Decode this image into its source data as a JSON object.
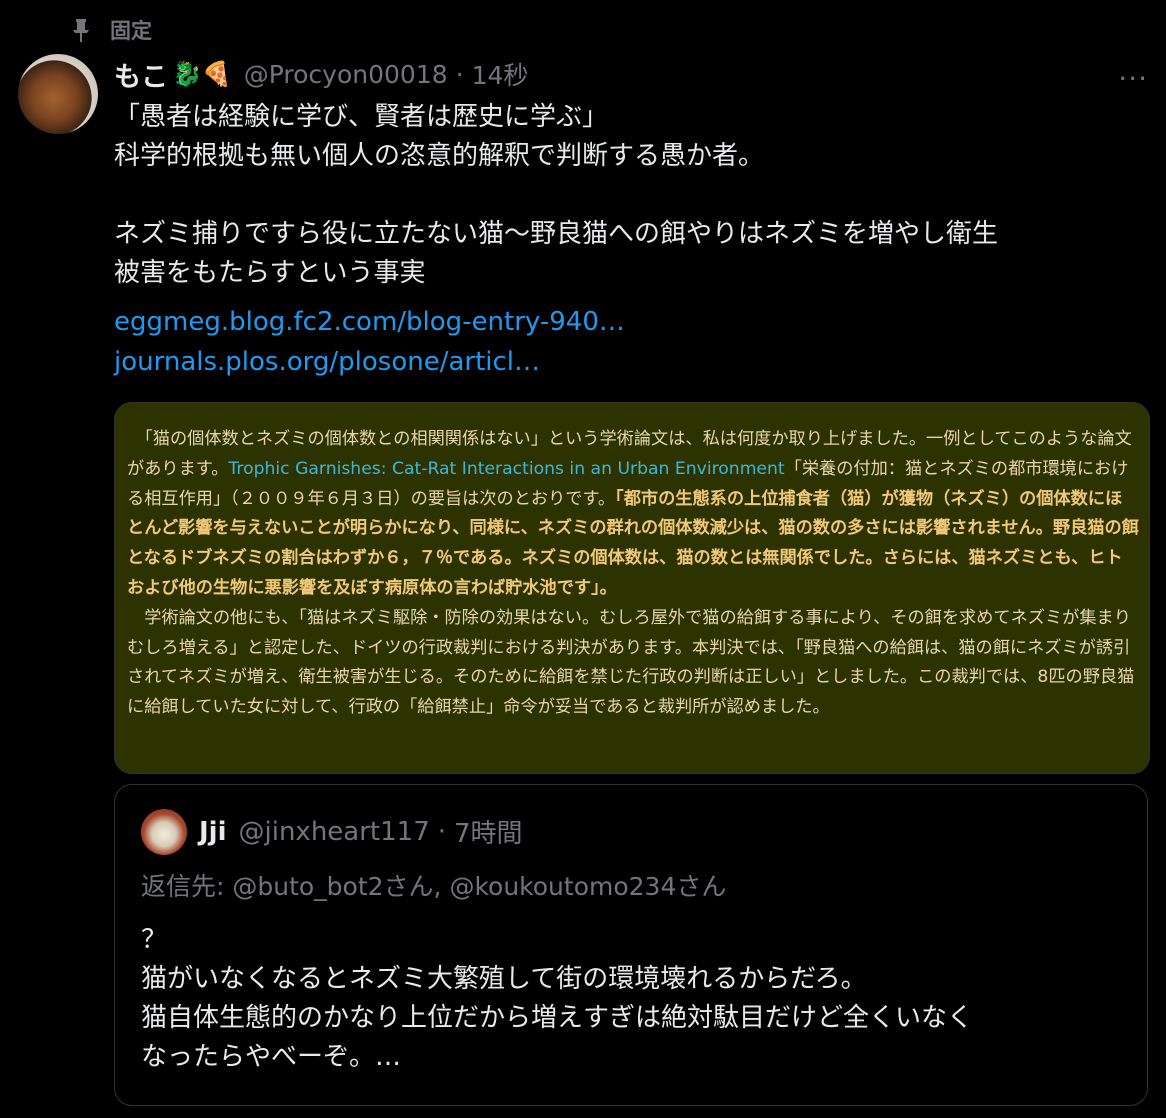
{
  "pinned": {
    "label": "固定",
    "icon": "pin-icon"
  },
  "tweet": {
    "name": "もこ",
    "emojis": "🐉🍕",
    "handle": "@Procyon00018",
    "separator": "·",
    "time": "14秒",
    "more": "···",
    "lines": [
      "「愚者は経験に学び、賢者は歴史に学ぶ」",
      "科学的根拠も無い個人の恣意的解釈で判断する愚か者。",
      "",
      "ネズミ捕りですら役に立たない猫〜野良猫への餌やりはネズミを増やし衛生",
      "被害をもたらすという事実"
    ],
    "links": [
      "eggmeg.blog.fc2.com/blog-entry-940…",
      "journals.plos.org/plosone/articl…"
    ]
  },
  "media": {
    "p1_a": "「猫の個体数とネズミの個体数との相関関係はない」という学術論文は、私は何度か取り上げました。一例としてこのような論文があります。",
    "p1_link": "Trophic Garnishes: Cat-Rat Interactions in an Urban Environment",
    "p1_b": "「栄養の付加：猫とネズミの都市環境における相互作用」（２００９年６月３日）の要旨は次のとおりです。",
    "p1_bold": "「都市の生態系の上位捕食者（猫）が獲物（ネズミ）の個体数にほとんど影響を与えないことが明らかになり、同様に、ネズミの群れの個体数減少は、猫の数の多さには影響されません。野良猫の餌となるドブネズミの割合はわずか６，７％である。ネズミの個体数は、猫の数とは無関係でした。さらには、猫ネズミとも、ヒトおよび他の生物に悪影響を及ぼす病原体の言わば貯水池です」。",
    "p2": "学術論文の他にも、「猫はネズミ駆除・防除の効果はない。むしろ屋外で猫の給餌する事により、その餌を求めてネズミが集まりむしろ増える」と認定した、ドイツの行政裁判における判決があります。本判決では、「野良猫への給餌は、猫の餌にネズミが誘引されてネズミが増え、衛生被害が生じる。そのために給餌を禁じた行政の判断は正しい」としました。この裁判では、8匹の野良猫に給餌していた女に対して、行政の「給餌禁止」命令が妥当であると裁判所が認めました。"
  },
  "quote": {
    "name": "Jji",
    "handle": "@jinxheart117",
    "separator": "·",
    "time": "7時間",
    "reply_to": "返信先: @buto_bot2さん, @koukoutomo234さん",
    "lines": [
      "？",
      "猫がいなくなるとネズミ大繁殖して街の環境壊れるからだろ。",
      "猫自体生態的のかなり上位だから増えすぎは絶対駄目だけど全くいなく",
      "なったらやべーぞ。…"
    ]
  }
}
